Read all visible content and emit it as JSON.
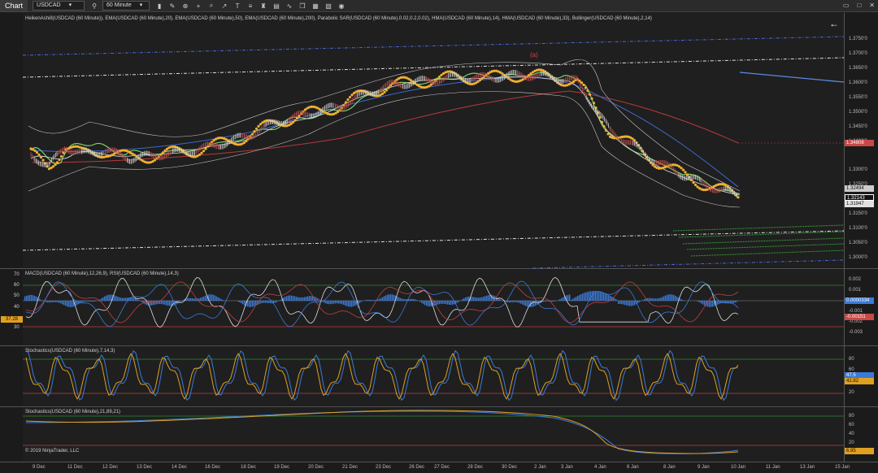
{
  "toolbar": {
    "chart_tab": "Chart",
    "instrument": "USDCAD",
    "interval": "60 Minute",
    "icons": [
      "search-icon",
      "bar-type-icon",
      "pencil-icon",
      "crosshair-icon",
      "plus-icon",
      "zoom-icon",
      "arrow-icon",
      "text-icon",
      "properties-icon",
      "strategy-icon",
      "layers-icon",
      "indicator-icon",
      "copy-icon",
      "grid-icon",
      "template-icon",
      "camera-icon"
    ]
  },
  "window_controls": {
    "minimize": "▭",
    "maximize": "□",
    "close": "✕"
  },
  "panels": {
    "price": {
      "indicators_label": "HeikenAshi8(USDCAD (60 Minute)), EMA(USDCAD (60 Minute),20), EMA(USDCAD (60 Minute),50), EMA(USDCAD (60 Minute),200), Parabolic SAR(USDCAD (60 Minute),0.02,0.2,0.02), HMA(USDCAD (60 Minute),14), HMA(USDCAD (60 Minute),33), Bollinger(USDCAD (60 Minute),2,14)",
      "annotation": "(a)",
      "y_ticks": [
        "1.3750'0",
        "1.3700'0",
        "1.3650'0",
        "1.3600'0",
        "1.3550'0",
        "1.3500'0",
        "1.3450'0",
        "1.3400'0",
        "1.3300'0",
        "1.3250'0",
        "1.3200'0",
        "1.3150'0",
        "1.3100'0",
        "1.3050'0",
        "1.3000'0"
      ],
      "price_boxes": [
        "1.34808",
        "1.32494",
        "1.32143",
        "1.31947"
      ],
      "colors": {
        "ema200": "#c0392b",
        "sar": "#f0b030",
        "hma": "#7fd06a",
        "bollinger": "#bbbbbb",
        "trendline": "#dddddd",
        "channel": "#5577dd"
      }
    },
    "macd": {
      "label": "MACD(USDCAD (60 Minute),12,26,9), RSI(USDCAD (60 Minute),14,3)",
      "left_ticks": [
        "70",
        "60",
        "50",
        "40",
        "30"
      ],
      "right_ticks": [
        "0.002",
        "0.001",
        "0",
        "-0.001",
        "-0.002",
        "-0.003"
      ],
      "left_box": "37.28",
      "right_boxes": [
        "0.0000334",
        "-0.00151"
      ]
    },
    "stoch1": {
      "label": "Stochastics(USDCAD (60 Minute),7,14,3)",
      "right_ticks": [
        "80",
        "60",
        "40",
        "20"
      ],
      "right_boxes": [
        "47.5",
        "42.82"
      ]
    },
    "stoch2": {
      "label": "Stochastics(USDCAD (60 Minute),21,89,21)",
      "right_ticks": [
        "80",
        "60",
        "40",
        "20"
      ],
      "right_box": "6.95",
      "copyright": "© 2019 NinjaTrader, LLC"
    }
  },
  "x_axis": [
    "9 Dec",
    "11 Dec",
    "12 Dec",
    "13 Dec",
    "14 Dec",
    "16 Dec",
    "18 Dec",
    "19 Dec",
    "20 Dec",
    "21 Dec",
    "23 Dec",
    "26 Dec",
    "27 Dec",
    "28 Dec",
    "30 Dec",
    "2 Jan",
    "3 Jan",
    "4 Jan",
    "6 Jan",
    "8 Jan",
    "9 Jan",
    "10 Jan",
    "11 Jan",
    "13 Jan",
    "15 Jan"
  ]
}
